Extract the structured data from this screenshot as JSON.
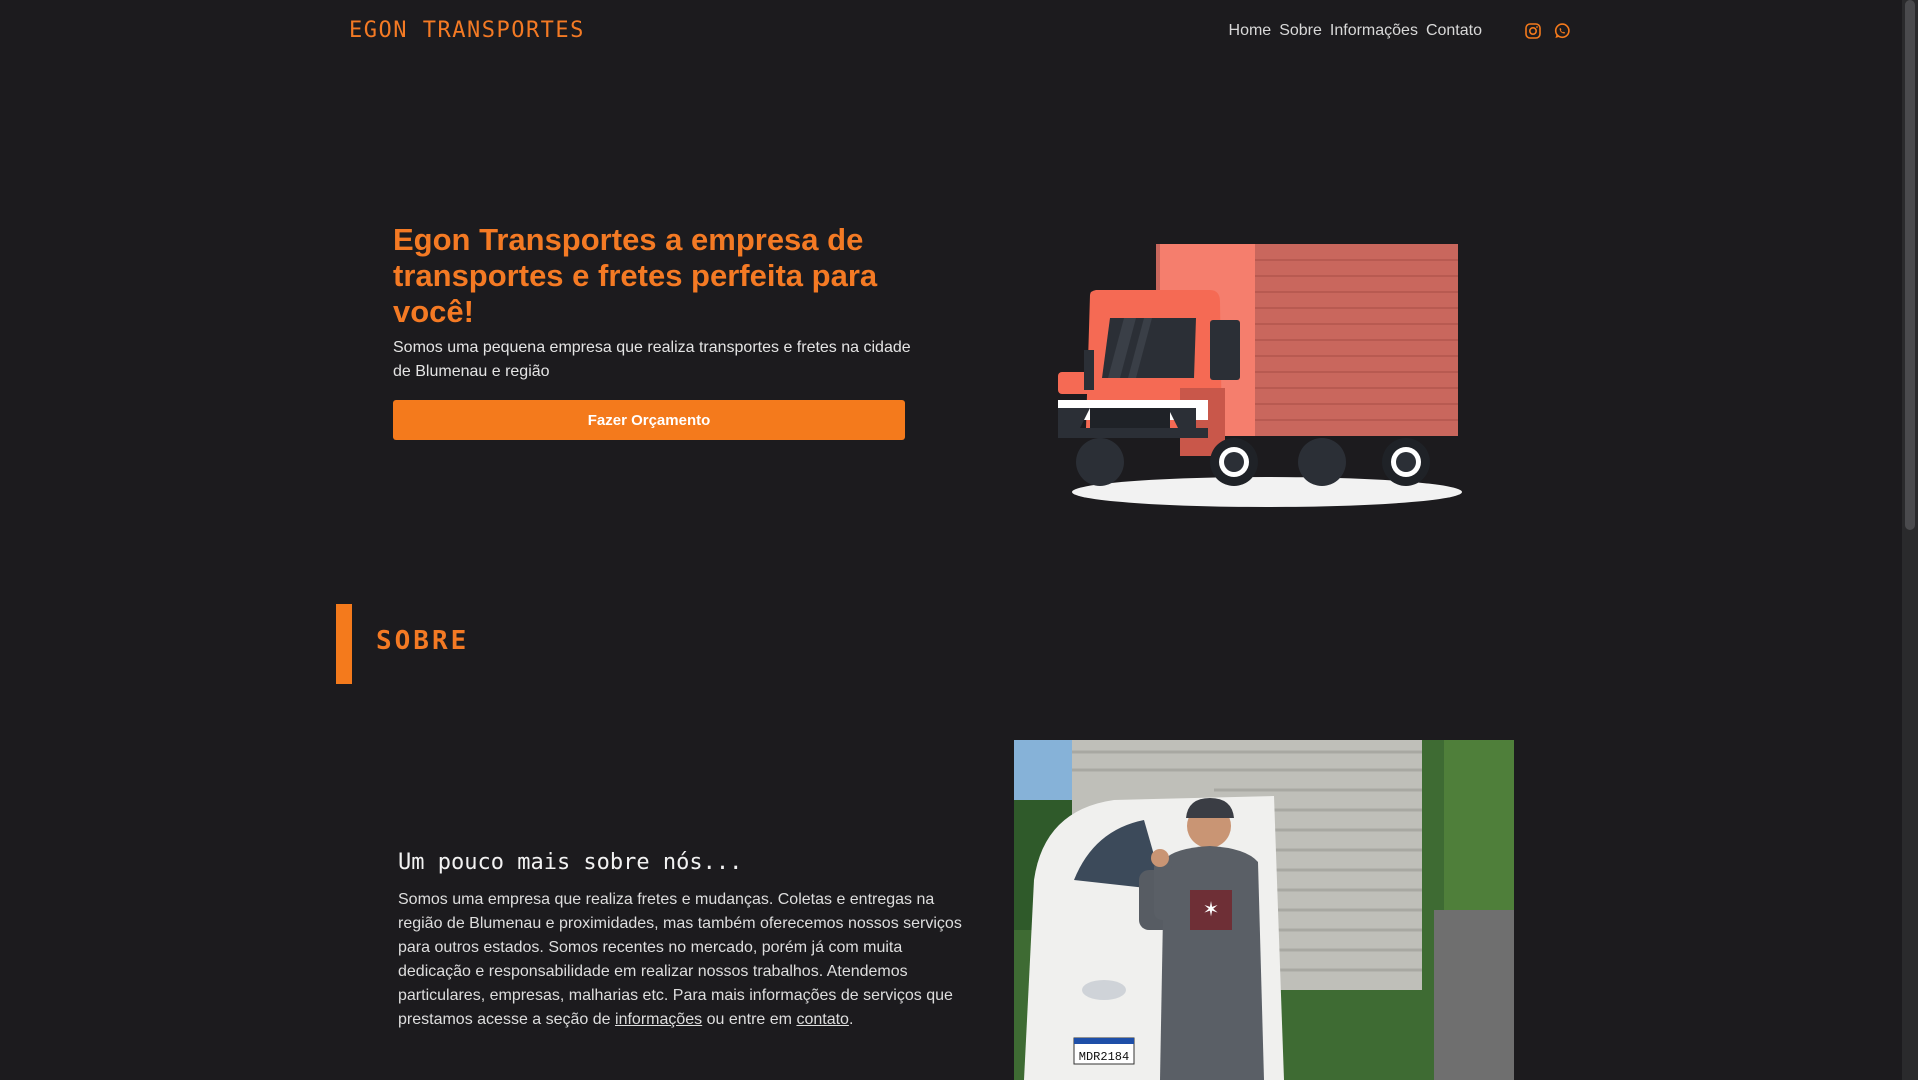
{
  "brand": "EGON TRANSPORTES",
  "nav": {
    "links": [
      "Home",
      "Sobre",
      "Informações",
      "Contato"
    ],
    "social": [
      "instagram-icon",
      "whatsapp-icon"
    ]
  },
  "hero": {
    "title": "Egon Transportes a empresa de transportes e fretes perfeita para você!",
    "subtitle": "Somos uma pequena empresa que realiza transportes e fretes na cidade de Blumenau e região",
    "cta_label": "Fazer Orçamento"
  },
  "about": {
    "section_title": "SOBRE",
    "heading": "Um pouco mais sobre nós...",
    "text_before": "Somos uma empresa que realiza fretes e mudanças. Coletas e entregas na região de Blumenau e proximidades, mas também oferecemos nossos serviços para outros estados. Somos recentes no mercado, porém já com muita dedicação e responsabilidade em realizar nossos trabalhos. Atendemos particulares, empresas, malharias etc. Para mais informações de serviços que prestamos acesse a seção de ",
    "link_info": "informações",
    "text_middle": " ou entre em ",
    "link_contact": "contato",
    "text_after": ".",
    "photo_plate": "MDR2184"
  },
  "colors": {
    "accent": "#f47a1c",
    "background": "#1c1b1e"
  }
}
